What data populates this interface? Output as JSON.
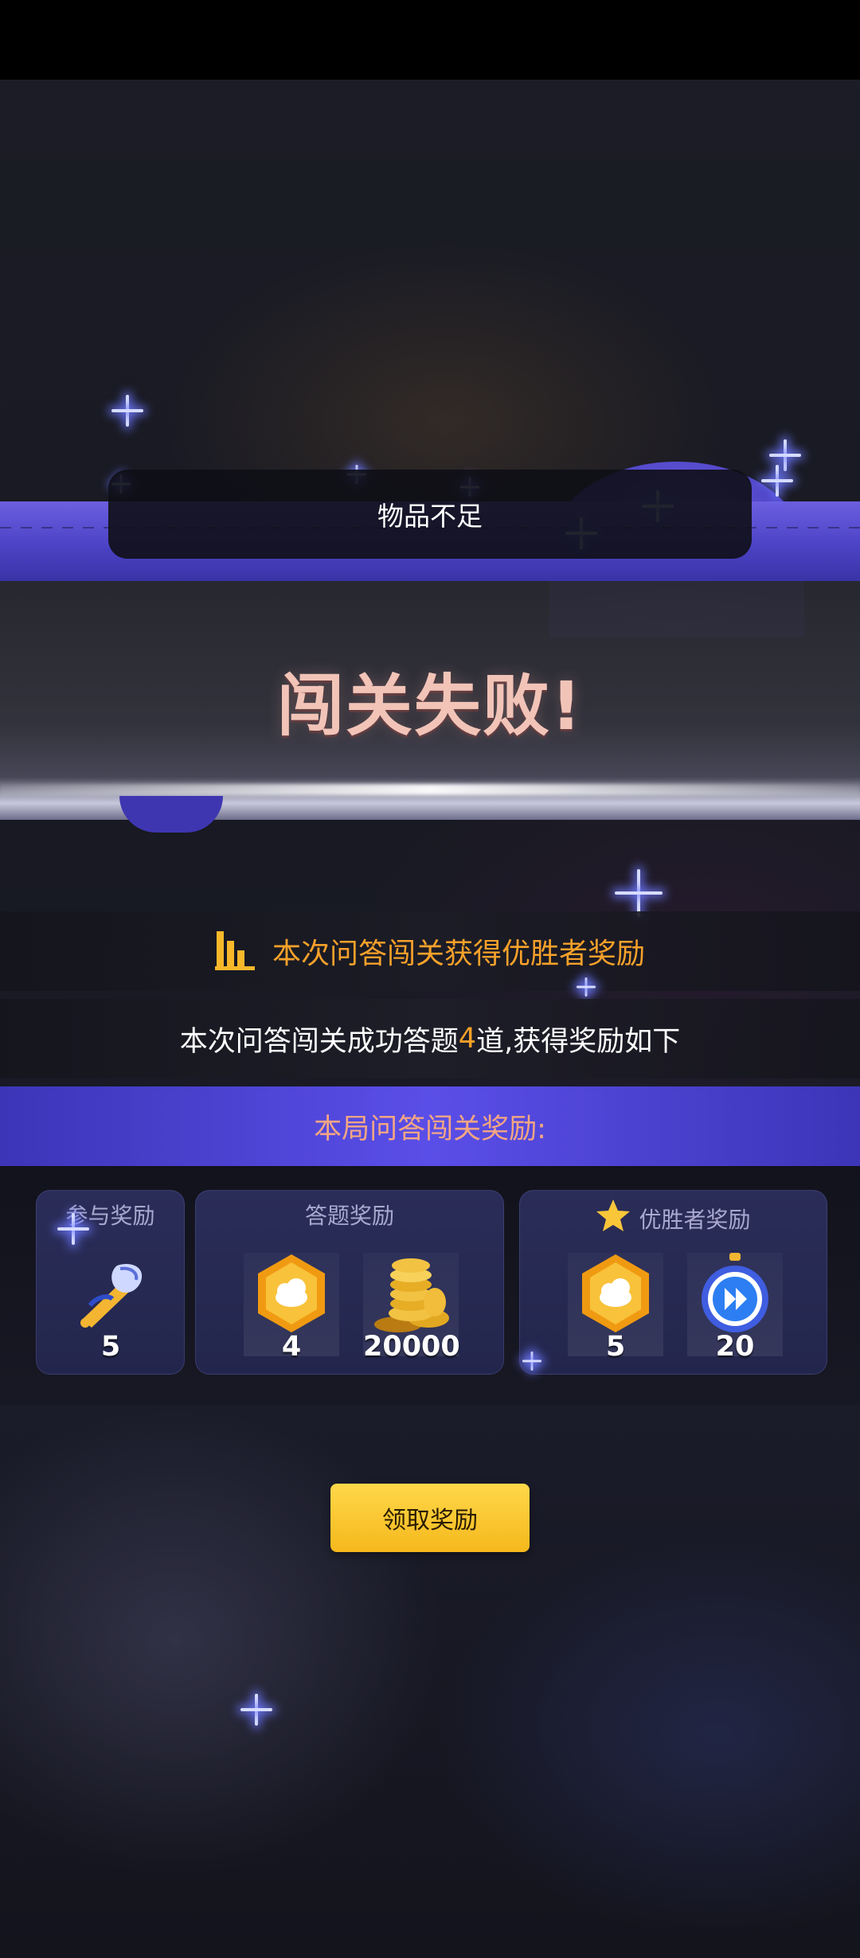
{
  "toast": {
    "message": "物品不足"
  },
  "result": {
    "title": "闯关失败!"
  },
  "winner_banner": {
    "text": "本次问答闯关获得优胜者奖励"
  },
  "summary": {
    "prefix": "本次问答闯关成功答题",
    "count": "4",
    "suffix": "道,获得奖励如下"
  },
  "rewards_header": {
    "text": "本局问答闯关奖励:"
  },
  "cards": {
    "participation": {
      "title": "参与奖励",
      "items": [
        {
          "icon": "horn-feather-icon",
          "count": "5"
        }
      ]
    },
    "answers": {
      "title": "答题奖励",
      "items": [
        {
          "icon": "gold-hexagon-badge-icon",
          "count": "4"
        },
        {
          "icon": "gold-coins-icon",
          "count": "20000"
        }
      ]
    },
    "winner": {
      "title": "优胜者奖励",
      "items": [
        {
          "icon": "gold-hexagon-badge-icon",
          "count": "5"
        },
        {
          "icon": "fast-forward-stopwatch-icon",
          "count": "20"
        }
      ]
    }
  },
  "claim_button": {
    "label": "领取奖励"
  },
  "colors": {
    "accent_orange": "#f7a12a",
    "button_yellow": "#f5b81c",
    "header_purple": "#5a4ee8",
    "fail_title": "#f2c4b8"
  }
}
